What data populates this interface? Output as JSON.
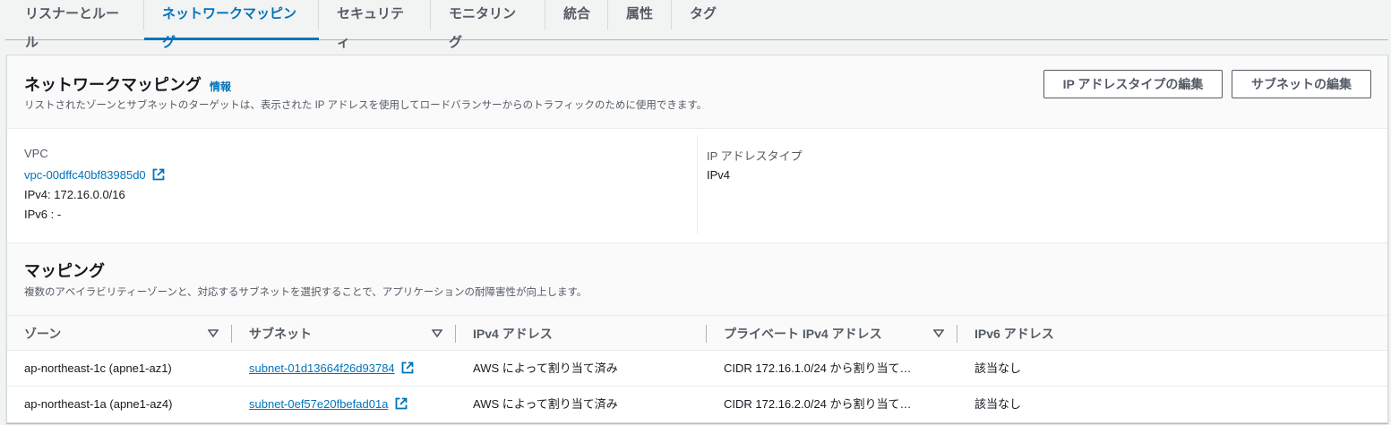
{
  "tabs": [
    {
      "label": "リスナーとルール",
      "active": false
    },
    {
      "label": "ネットワークマッピング",
      "active": true
    },
    {
      "label": "セキュリティ",
      "active": false
    },
    {
      "label": "モニタリング",
      "active": false
    },
    {
      "label": "統合",
      "active": false
    },
    {
      "label": "属性",
      "active": false
    },
    {
      "label": "タグ",
      "active": false
    }
  ],
  "section": {
    "title": "ネットワークマッピング",
    "info": "情報",
    "description": "リストされたゾーンとサブネットのターゲットは、表示された IP アドレスを使用してロードバランサーからのトラフィックのために使用できます。",
    "edit_ip_type_button": "IP アドレスタイプの編集",
    "edit_subnets_button": "サブネットの編集"
  },
  "vpc": {
    "label": "VPC",
    "id": "vpc-00dffc40bf83985d0",
    "ipv4": "IPv4: 172.16.0.0/16",
    "ipv6": "IPv6 : -"
  },
  "ip_type": {
    "label": "IP アドレスタイプ",
    "value": "IPv4"
  },
  "mappings": {
    "title": "マッピング",
    "description": "複数のアベイラビリティーゾーンと、対応するサブネットを選択することで、アプリケーションの耐障害性が向上します。",
    "columns": [
      "ゾーン",
      "サブネット",
      "IPv4 アドレス",
      "プライベート IPv4 アドレス",
      "IPv6 アドレス"
    ],
    "rows": [
      {
        "zone": "ap-northeast-1c (apne1-az1)",
        "subnet": "subnet-01d13664f26d93784",
        "ipv4": "AWS によって割り当て済み",
        "private_ipv4": "CIDR 172.16.1.0/24 から割り当て…",
        "ipv6": "該当なし"
      },
      {
        "zone": "ap-northeast-1a (apne1-az4)",
        "subnet": "subnet-0ef57e20fbefad01a",
        "ipv4": "AWS によって割り当て済み",
        "private_ipv4": "CIDR 172.16.2.0/24 から割り当て…",
        "ipv6": "該当なし"
      }
    ]
  },
  "colors": {
    "accent": "#0073bb",
    "text": "#16191f",
    "secondary": "#545b64"
  }
}
